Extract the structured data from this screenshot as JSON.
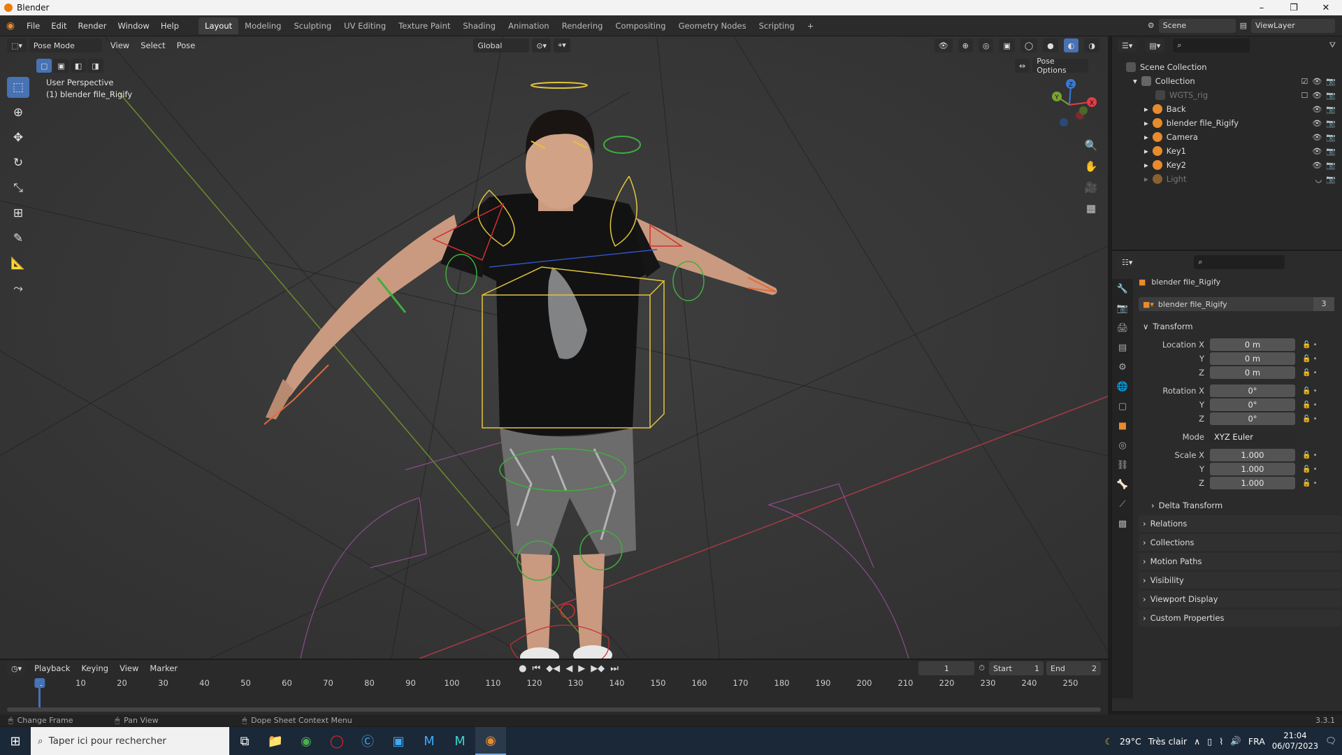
{
  "window": {
    "title": "Blender",
    "minimize": "–",
    "maximize": "❐",
    "close": "✕"
  },
  "menu": [
    "File",
    "Edit",
    "Render",
    "Window",
    "Help"
  ],
  "workspaces": [
    "Layout",
    "Modeling",
    "Sculpting",
    "UV Editing",
    "Texture Paint",
    "Shading",
    "Animation",
    "Rendering",
    "Compositing",
    "Geometry Nodes",
    "Scripting"
  ],
  "active_workspace": "Layout",
  "add_workspace": "+",
  "scene": {
    "label": "Scene",
    "viewlayer": "ViewLayer"
  },
  "viewport_header": {
    "mode": "Pose Mode",
    "menus": [
      "View",
      "Select",
      "Pose"
    ],
    "transform_orientation": "Global",
    "pose_options": "Pose Options"
  },
  "viewport_info": {
    "line1": "User Perspective",
    "line2": "(1) blender file_Rigify"
  },
  "gizmo_axes": [
    "X",
    "Y",
    "Z"
  ],
  "outliner": {
    "root": "Scene Collection",
    "collection": "Collection",
    "items": [
      {
        "name": "WGTS_rig",
        "dim": true
      },
      {
        "name": "Back",
        "dim": false
      },
      {
        "name": "blender file_Rigify",
        "dim": false
      },
      {
        "name": "Camera",
        "dim": false
      },
      {
        "name": "Key1",
        "dim": false
      },
      {
        "name": "Key2",
        "dim": false
      },
      {
        "name": "Light",
        "dim": true
      }
    ]
  },
  "properties": {
    "object_name": "blender file_Rigify",
    "datablock_name": "blender file_Rigify",
    "users": "3",
    "transform_label": "Transform",
    "location": {
      "label": "Location X",
      "x": "0 m",
      "y": "0 m",
      "z": "0 m"
    },
    "rotation": {
      "label": "Rotation X",
      "x": "0°",
      "y": "0°",
      "z": "0°"
    },
    "axis_y": "Y",
    "axis_z": "Z",
    "mode_label": "Mode",
    "mode_value": "XYZ Euler",
    "scale": {
      "label": "Scale X",
      "x": "1.000",
      "y": "1.000",
      "z": "1.000"
    },
    "sections": [
      "Delta Transform",
      "Relations",
      "Collections",
      "Motion Paths",
      "Visibility",
      "Viewport Display",
      "Custom Properties"
    ]
  },
  "timeline": {
    "menus": [
      "Playback",
      "Keying",
      "View",
      "Marker"
    ],
    "current_frame": "1",
    "start_label": "Start",
    "start": "1",
    "end_label": "End",
    "end": "2",
    "ruler": [
      "1",
      "10",
      "20",
      "30",
      "40",
      "50",
      "60",
      "70",
      "80",
      "90",
      "100",
      "110",
      "120",
      "130",
      "140",
      "150",
      "160",
      "170",
      "180",
      "190",
      "200",
      "210",
      "220",
      "230",
      "240",
      "250"
    ]
  },
  "statusbar": {
    "item1": "Change Frame",
    "item2": "Pan View",
    "item3": "Dope Sheet Context Menu",
    "version": "3.3.1"
  },
  "taskbar": {
    "search_placeholder": "Taper ici pour rechercher",
    "weather_temp": "29°C",
    "weather_text": "Très clair",
    "language": "FRA",
    "time": "21:04",
    "date": "06/07/2023"
  },
  "colors": {
    "accent": "#4772b3",
    "orange": "#e88b2d",
    "x_axis": "#e23c48",
    "y_axis": "#7ba331",
    "z_axis": "#3a78d8"
  }
}
